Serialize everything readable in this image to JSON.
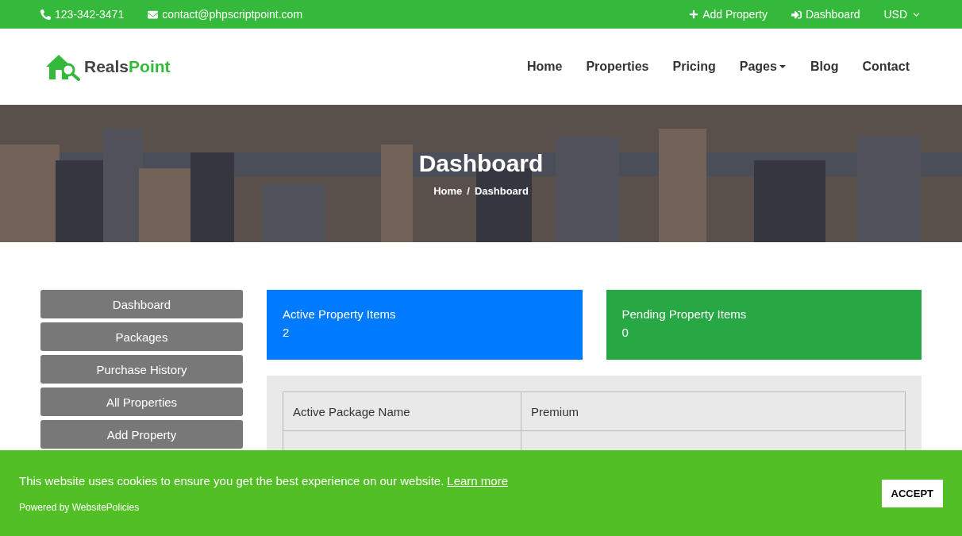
{
  "top_bar": {
    "phone": "123-342-3471",
    "email": "contact@phpscriptpoint.com",
    "links": [
      {
        "kind": "add",
        "label": "Add Property"
      },
      {
        "kind": "login",
        "label": "Dashboard"
      }
    ],
    "currency": "USD"
  },
  "logo": {
    "dark": "Reals",
    "accent": "Point"
  },
  "nav": [
    {
      "label": "Home",
      "has_menu": false
    },
    {
      "label": "Properties",
      "has_menu": false
    },
    {
      "label": "Pricing",
      "has_menu": false
    },
    {
      "label": "Pages",
      "has_menu": true
    },
    {
      "label": "Blog",
      "has_menu": false
    },
    {
      "label": "Contact",
      "has_menu": false
    }
  ],
  "hero": {
    "kind": "picture",
    "title": "Dashboard",
    "breadcrumb": [
      "Home",
      "Dashboard"
    ],
    "separator": "/"
  },
  "sidebar": {
    "items": [
      "Dashboard",
      "Packages",
      "Purchase History",
      "All Properties",
      "Add Property"
    ]
  },
  "stats": [
    {
      "label": "Active Property Items",
      "value": "2",
      "color": "#007bff"
    },
    {
      "label": "Pending Property Items",
      "value": "0",
      "color": "#28a745"
    }
  ],
  "package_table": {
    "rows": [
      [
        "Active Package Name",
        "Premium"
      ]
    ]
  },
  "cookie_banner": {
    "message": "This website uses cookies to ensure you get the best experience on our website.",
    "link": "Learn more",
    "powered_by": "Powered by WebsitePolicies",
    "button": "ACCEPT"
  }
}
